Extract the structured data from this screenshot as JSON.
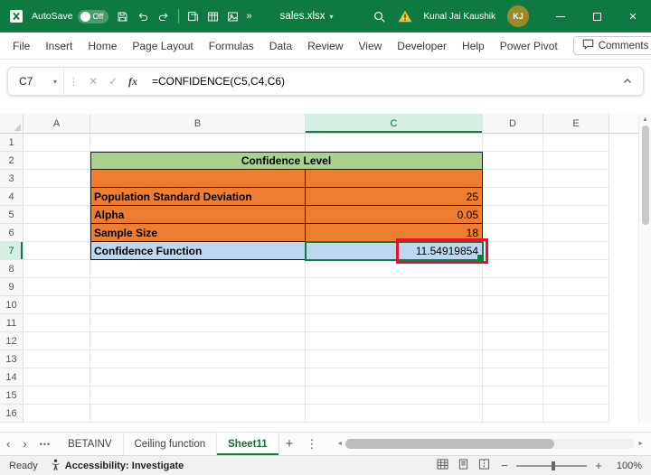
{
  "colors": {
    "titlebar": "#0E7A41",
    "accent": "#107C41"
  },
  "title_bar": {
    "autosave_label": "AutoSave",
    "autosave_state": "Off",
    "filename": "sales.xlsx",
    "user_name": "Kunal Jai Kaushik",
    "user_initials": "KJ"
  },
  "ribbon": {
    "tabs": [
      "File",
      "Insert",
      "Home",
      "Page Layout",
      "Formulas",
      "Data",
      "Review",
      "View",
      "Developer",
      "Help",
      "Power Pivot"
    ],
    "comments_label": "Comments"
  },
  "formula_bar": {
    "name_box": "C7",
    "fx_label": "fx",
    "formula": "=CONFIDENCE(C5,C4,C6)"
  },
  "grid": {
    "column_headers": [
      "A",
      "B",
      "C",
      "D",
      "E"
    ],
    "row_numbers": [
      "1",
      "2",
      "3",
      "4",
      "5",
      "6",
      "7",
      "8",
      "9",
      "10",
      "11",
      "12",
      "13",
      "14",
      "15",
      "16"
    ],
    "selected_column": "C",
    "selected_row": 7,
    "table": {
      "title": "Confidence Level",
      "rows": [
        {
          "row": 3,
          "label": "",
          "value": ""
        },
        {
          "row": 4,
          "label": "Population Standard Deviation",
          "value": "25"
        },
        {
          "row": 5,
          "label": "Alpha",
          "value": "0.05"
        },
        {
          "row": 6,
          "label": "Sample Size",
          "value": "18"
        },
        {
          "row": 7,
          "label": "Confidence Function",
          "value": "11.54919854"
        }
      ],
      "colors": {
        "title_fill": "#A9D08E",
        "data_fill": "#ED7D31",
        "result_fill": "#BDD7EE",
        "annotation_border": "#E8112D"
      }
    }
  },
  "sheet_bar": {
    "tabs": [
      {
        "label": "BETAINV",
        "active": false
      },
      {
        "label": "Ceiling function",
        "active": false
      },
      {
        "label": "Sheet11",
        "active": true
      }
    ]
  },
  "status_bar": {
    "mode": "Ready",
    "accessibility": "Accessibility: Investigate",
    "zoom": "100%"
  }
}
